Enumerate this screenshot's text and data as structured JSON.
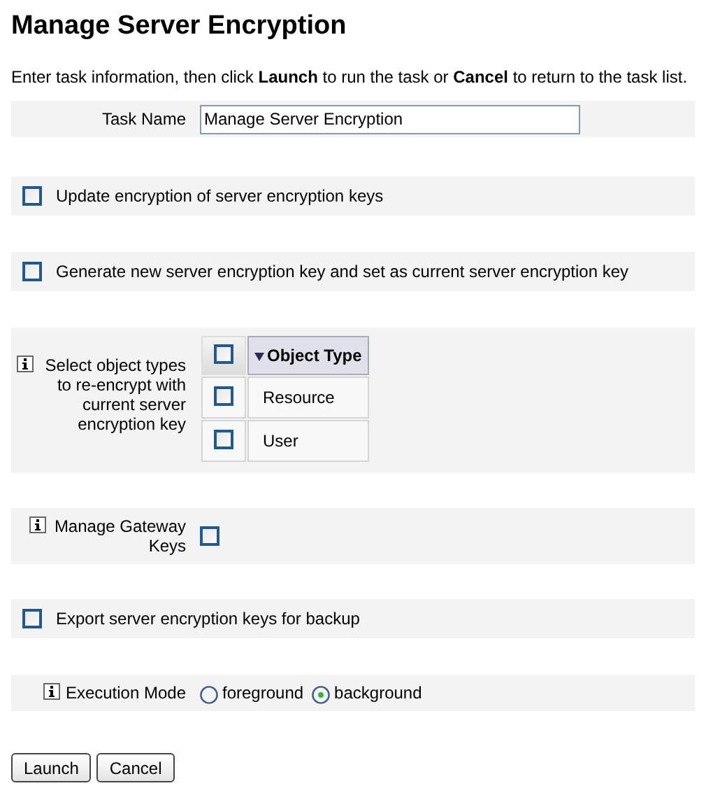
{
  "title": "Manage Server Encryption",
  "intro": "Enter task information, then click **Launch** to run the task or **Cancel** to return to the task list.",
  "sections": [
    {
      "kind": "text",
      "label": "Task Name",
      "value": "Manage Server Encryption"
    },
    {
      "kind": "checkbox",
      "label": "Update encryption of server encryption keys",
      "checked": false
    },
    {
      "kind": "checkbox",
      "label": "Generate new server encryption key and set as current server encryption key",
      "checked": false
    },
    {
      "kind": "table",
      "info": true,
      "label": "Select object types to re-encrypt with current server encryption key",
      "header_checked": false,
      "column": "Object Type",
      "rows": [
        {
          "label": "Resource",
          "checked": false
        },
        {
          "label": "User",
          "checked": false
        }
      ]
    },
    {
      "kind": "labeled_checkbox",
      "info": true,
      "label": "Manage Gateway Keys",
      "checked": false
    },
    {
      "kind": "checkbox",
      "label": "Export server encryption keys for backup",
      "checked": false
    },
    {
      "kind": "radio",
      "info": true,
      "label": "Execution Mode",
      "options": [
        {
          "label": "foreground",
          "selected": false
        },
        {
          "label": "background",
          "selected": true
        }
      ]
    }
  ],
  "buttons": [
    "Launch",
    "Cancel"
  ]
}
